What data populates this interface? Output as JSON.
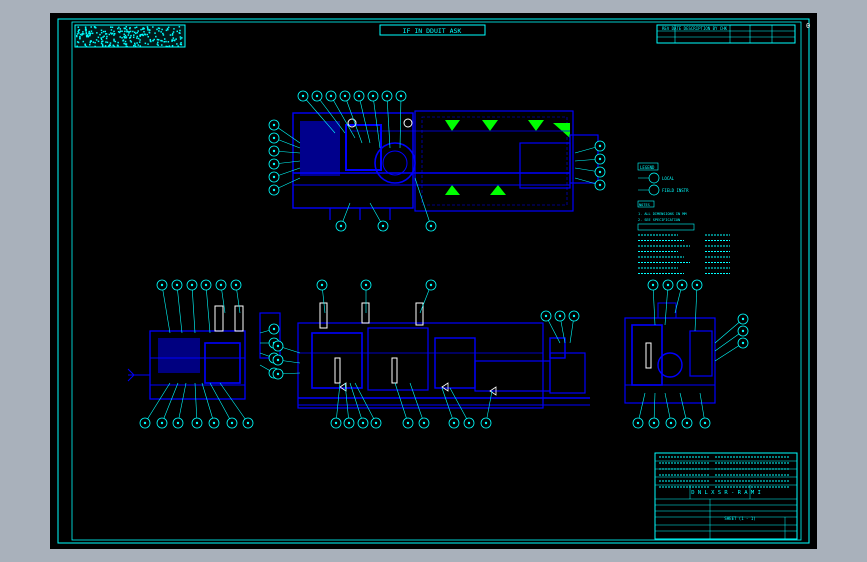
{
  "title_banner": "IF   IN   DDUIT   ASK",
  "corner_label": "0",
  "colors": {
    "background": "#000000",
    "frame": "#00ffff",
    "linework": "#0000ff",
    "text": "#00ffff",
    "hatch": "#00ff00",
    "dim": "#aaaaff"
  },
  "legend": {
    "header": "LEGEND",
    "item_1": "LOCAL",
    "item_2": "FIELD INSTR"
  },
  "notes": {
    "header": "NOTES",
    "line_1": "1. ALL DIMENSIONS IN MM",
    "line_2": "2. SEE SPECIFICATION"
  },
  "revision_header": "REV   DATE   DESCRIPTION   BY   CHK",
  "title_block": {
    "drawing_title": "D N L X S R - R A M I",
    "sheet": "SHEET (1 - 1)"
  }
}
